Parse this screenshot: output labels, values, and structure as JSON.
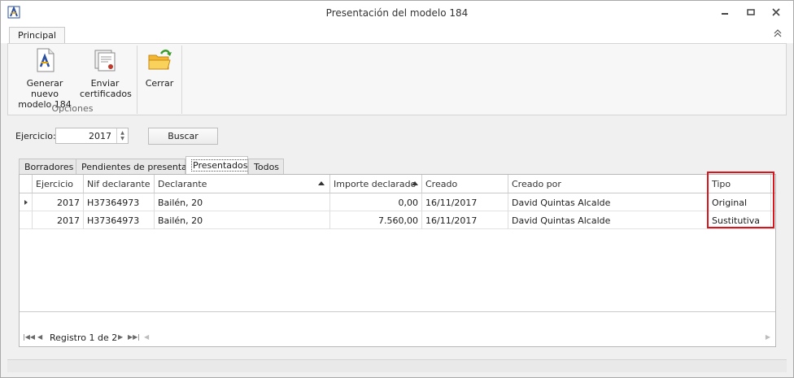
{
  "window": {
    "title": "Presentación del modelo 184",
    "app_icon": "aeat-logo-icon",
    "controls": [
      "minimize-icon",
      "restore-icon",
      "close-icon"
    ]
  },
  "ribbon": {
    "tab": "Principal",
    "collapse_icon": "chevron-up-icon",
    "buttons": [
      {
        "label_line1": "Generar nuevo",
        "label_line2": "modelo 184",
        "icon": "document-aeat-icon"
      },
      {
        "label_line1": "Enviar",
        "label_line2": "certificados",
        "icon": "certificates-icon"
      },
      {
        "label_line1": "Cerrar",
        "label_line2": "",
        "icon": "folder-exit-icon"
      }
    ],
    "group_label": "Opciones"
  },
  "filters": {
    "ejercicio_label": "Ejercicio:",
    "ejercicio_value": "2017",
    "buscar_label": "Buscar"
  },
  "tabs": [
    {
      "label": "Borradores"
    },
    {
      "label": "Pendientes de presentar"
    },
    {
      "label": "Presentados",
      "active": true
    },
    {
      "label": "Todos"
    }
  ],
  "grid": {
    "columns": [
      "Ejercicio",
      "Nif declarante",
      "Declarante",
      "Importe declarado",
      "Creado",
      "Creado por",
      "Tipo"
    ],
    "sorted_columns": [
      "Declarante",
      "Importe declarado"
    ],
    "rows": [
      {
        "ejercicio": "2017",
        "nif": "H37364973",
        "declarante": "Bailén, 20",
        "importe": "0,00",
        "creado": "16/11/2017",
        "creado_por": "David Quintas Alcalde",
        "tipo": "Original"
      },
      {
        "ejercicio": "2017",
        "nif": "H37364973",
        "declarante": "Bailén, 20",
        "importe": "7.560,00",
        "creado": "16/11/2017",
        "creado_por": "David Quintas Alcalde",
        "tipo": "Sustitutiva"
      }
    ],
    "highlight_color": "#d9141c"
  },
  "navigator": {
    "record_text": "Registro 1 de 2"
  }
}
